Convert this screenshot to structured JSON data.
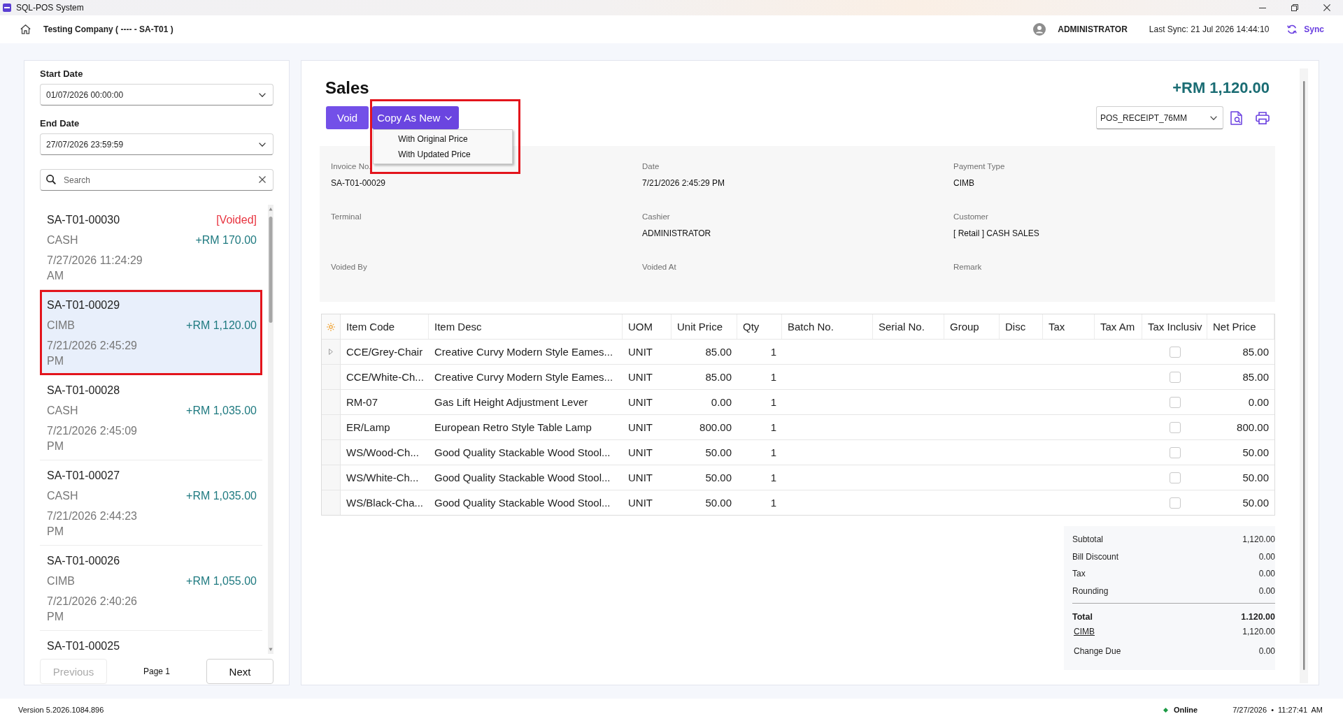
{
  "window": {
    "title": "SQL-POS System"
  },
  "header": {
    "company": "Testing Company ( ---- - SA-T01 )",
    "user": "ADMINISTRATOR",
    "last_sync": "Last Sync: 21 Jul 2026 14:44:10",
    "sync": "Sync"
  },
  "filters": {
    "start_date": {
      "label": "Start Date",
      "value": "01/07/2026 00:00:00"
    },
    "end_date": {
      "label": "End Date",
      "value": "27/07/2026 23:59:59"
    },
    "search": {
      "placeholder": "Search"
    }
  },
  "sales_list": [
    {
      "invoice": "SA-T01-00030",
      "status": "[Voided]",
      "payment": "CASH",
      "amount": "+RM 170.00",
      "date": "7/27/2026 11:24:29 AM",
      "selected": false,
      "highlighted": false
    },
    {
      "invoice": "SA-T01-00029",
      "payment": "CIMB",
      "amount": "+RM 1,120.00",
      "date": "7/21/2026 2:45:29 PM",
      "selected": true,
      "highlighted": true
    },
    {
      "invoice": "SA-T01-00028",
      "payment": "CASH",
      "amount": "+RM 1,035.00",
      "date": "7/21/2026 2:45:09 PM",
      "selected": false,
      "highlighted": false
    },
    {
      "invoice": "SA-T01-00027",
      "payment": "CASH",
      "amount": "+RM 1,035.00",
      "date": "7/21/2026 2:44:23 PM",
      "selected": false,
      "highlighted": false
    },
    {
      "invoice": "SA-T01-00026",
      "payment": "CIMB",
      "amount": "+RM 1,055.00",
      "date": "7/21/2026 2:40:26 PM",
      "selected": false,
      "highlighted": false
    },
    {
      "invoice": "SA-T01-00025",
      "selected": false,
      "highlighted": false
    }
  ],
  "pagination": {
    "previous": {
      "label": "Previous",
      "disabled": true
    },
    "page": "Page 1",
    "next": {
      "label": "Next",
      "disabled": false
    }
  },
  "detail": {
    "title": "Sales",
    "total": "+RM 1,120.00",
    "actions": [
      {
        "kind": "button",
        "label": "Void"
      },
      {
        "kind": "dropdown",
        "label": "Copy As New",
        "expanded": true,
        "highlighted": true,
        "menu": [
          "With Original Price",
          "With Updated Price"
        ]
      }
    ],
    "receipt_template": "POS_RECEIPT_76MM",
    "fields": [
      {
        "label": "Invoice No.",
        "value": "SA-T01-00029"
      },
      {
        "label": "Date",
        "value": "7/21/2026 2:45:29 PM"
      },
      {
        "label": "Payment Type",
        "value": "CIMB"
      },
      {
        "label": "Terminal"
      },
      {
        "label": "Cashier",
        "value": "ADMINISTRATOR"
      },
      {
        "label": "Customer",
        "value": "[ Retail ] CASH SALES"
      },
      {
        "label": "Voided By"
      },
      {
        "label": "Voided At"
      },
      {
        "label": "Remark"
      }
    ]
  },
  "items_table": {
    "columns": [
      "Item Code",
      "Item Desc",
      "UOM",
      "Unit Price",
      "Qty",
      "Batch No.",
      "Serial No.",
      "Group",
      "Disc",
      "Tax",
      "Tax Am",
      "Tax Inclusiv",
      "Net Price"
    ],
    "rows": [
      {
        "expandable": true,
        "item_code": "CCE/Grey-Chair",
        "item_desc": "Creative Curvy Modern Style Eames...",
        "uom": "UNIT",
        "unit_price": "85.00",
        "qty": "1",
        "tax_inclusive": false,
        "net_price": "85.00"
      },
      {
        "expandable": false,
        "item_code": "CCE/White-Ch...",
        "item_desc": "Creative Curvy Modern Style Eames...",
        "uom": "UNIT",
        "unit_price": "85.00",
        "qty": "1",
        "tax_inclusive": false,
        "net_price": "85.00"
      },
      {
        "expandable": false,
        "item_code": "RM-07",
        "item_desc": "Gas Lift Height Adjustment Lever",
        "uom": "UNIT",
        "unit_price": "0.00",
        "qty": "1",
        "tax_inclusive": false,
        "net_price": "0.00"
      },
      {
        "expandable": false,
        "item_code": "ER/Lamp",
        "item_desc": "European Retro Style Table Lamp",
        "uom": "UNIT",
        "unit_price": "800.00",
        "qty": "1",
        "tax_inclusive": false,
        "net_price": "800.00"
      },
      {
        "expandable": false,
        "item_code": "WS/Wood-Ch...",
        "item_desc": "Good Quality Stackable Wood Stool...",
        "uom": "UNIT",
        "unit_price": "50.00",
        "qty": "1",
        "tax_inclusive": false,
        "net_price": "50.00"
      },
      {
        "expandable": false,
        "item_code": "WS/White-Ch...",
        "item_desc": "Good Quality Stackable Wood Stool...",
        "uom": "UNIT",
        "unit_price": "50.00",
        "qty": "1",
        "tax_inclusive": false,
        "net_price": "50.00"
      },
      {
        "expandable": false,
        "item_code": "WS/Black-Cha...",
        "item_desc": "Good Quality Stackable Wood Stool...",
        "uom": "UNIT",
        "unit_price": "50.00",
        "qty": "1",
        "tax_inclusive": false,
        "net_price": "50.00"
      }
    ]
  },
  "totals": [
    {
      "kind": "line",
      "label": "Subtotal",
      "value": "1,120.00"
    },
    {
      "kind": "line",
      "label": "Bill Discount",
      "value": "0.00"
    },
    {
      "kind": "line",
      "label": "Tax",
      "value": "0.00"
    },
    {
      "kind": "line",
      "label": "Rounding",
      "value": "0.00"
    },
    {
      "kind": "total",
      "label": "Total",
      "value": "1.120.00"
    },
    {
      "kind": "payment",
      "label": "CIMB",
      "value": "1,120.00"
    },
    {
      "kind": "change",
      "label": "Change Due",
      "value": "0.00"
    }
  ],
  "status_bar": {
    "version": "Version 5.2026.1084.896",
    "connection": {
      "label": "Online",
      "online": true
    },
    "datetime": "7/27/2026 • 11:27:41 AM"
  }
}
